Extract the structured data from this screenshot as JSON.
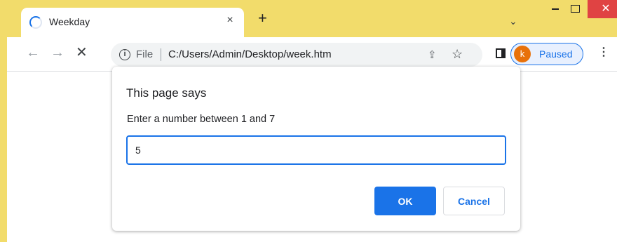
{
  "tab": {
    "title": "Weekday",
    "close_icon": "×",
    "new_tab_icon": "+"
  },
  "tab_search_icon": "⌄",
  "window_controls": {
    "close_icon": "✕"
  },
  "toolbar": {
    "back_icon": "←",
    "forward_icon": "→",
    "stop_icon": "✕",
    "info_icon": "i",
    "scheme_label": "File",
    "url": "C:/Users/Admin/Desktop/week.htm",
    "share_icon": "⇪",
    "star_icon": "☆",
    "profile": {
      "initial": "k",
      "label": "Paused",
      "avatar_color": "#e8710a"
    },
    "menu_icon": "⋮"
  },
  "dialog": {
    "title": "This page says",
    "message": "Enter a number between 1 and 7",
    "input_value": "5",
    "ok_label": "OK",
    "cancel_label": "Cancel"
  },
  "colors": {
    "accent": "#1a73e8",
    "frame": "#f2dc6b",
    "close_button": "#e04343"
  }
}
